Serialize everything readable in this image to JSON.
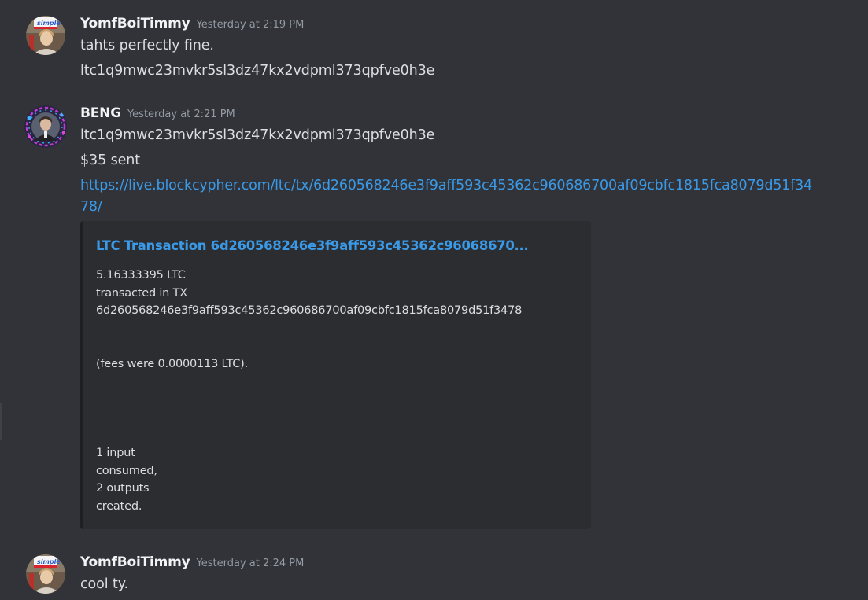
{
  "messages": [
    {
      "username": "YomfBoiTimmy",
      "timestamp": "Yesterday at 2:19 PM",
      "lines": [
        "tahts perfectly fine.",
        "ltc1q9mwc23mvkr5sl3dz47kx2vdpml373qpfve0h3e"
      ]
    },
    {
      "username": "BENG",
      "timestamp": "Yesterday at 2:21 PM",
      "lines": [
        "ltc1q9mwc23mvkr5sl3dz47kx2vdpml373qpfve0h3e",
        "$35 sent"
      ],
      "link": "https://live.blockcypher.com/ltc/tx/6d260568246e3f9aff593c45362c960686700af09cbfc1815fca8079d51f3478/",
      "embed": {
        "title": "LTC Transaction 6d260568246e3f9aff593c45362c96068670...",
        "description": [
          "5.16333395 LTC",
          "transacted in TX",
          "6d260568246e3f9aff593c45362c960686700af09cbfc1815fca8079d51f3478",
          "",
          "",
          "(fees were 0.0000113 LTC).",
          "",
          "",
          "",
          "",
          "1 input",
          "consumed,",
          "2 outputs",
          "created."
        ]
      }
    },
    {
      "username": "YomfBoiTimmy",
      "timestamp": "Yesterday at 2:24 PM",
      "lines": [
        "cool ty."
      ]
    }
  ],
  "colors": {
    "background": "#313338",
    "embed_background": "#2b2d31",
    "link": "#3a9ae8",
    "username": "#f2f3f5",
    "timestamp": "#949ba4",
    "text": "#dbdee1"
  },
  "icons": {
    "avatar_timmy": "avatar-person-with-simple-sign",
    "avatar_beng": "avatar-person-with-neon-ring"
  }
}
